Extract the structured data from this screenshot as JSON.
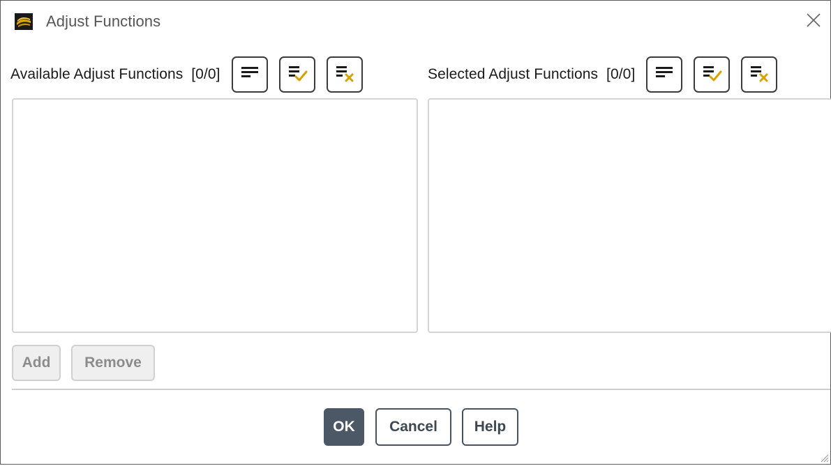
{
  "window": {
    "title": "Adjust Functions",
    "app_icon": "ansys-fluent-icon",
    "close_icon": "close-icon"
  },
  "available": {
    "label": "Available Adjust Functions",
    "count": "[0/0]",
    "items": [],
    "toolbar": [
      {
        "name": "list-view-icon",
        "tooltip": ""
      },
      {
        "name": "select-all-icon",
        "accent": "#d9a100"
      },
      {
        "name": "deselect-all-icon",
        "accent": "#d9a100"
      }
    ]
  },
  "selected": {
    "label": "Selected Adjust Functions",
    "count": "[0/0]",
    "items": [],
    "toolbar": [
      {
        "name": "list-view-icon"
      },
      {
        "name": "select-all-icon",
        "accent": "#d9a100"
      },
      {
        "name": "deselect-all-icon",
        "accent": "#d9a100"
      }
    ]
  },
  "actions": {
    "add_label": "Add",
    "remove_label": "Remove"
  },
  "footer": {
    "ok_label": "OK",
    "cancel_label": "Cancel",
    "help_label": "Help"
  },
  "colors": {
    "primary_button": "#4c5866",
    "accent": "#d9a100",
    "disabled_text": "#8c8c8c"
  }
}
